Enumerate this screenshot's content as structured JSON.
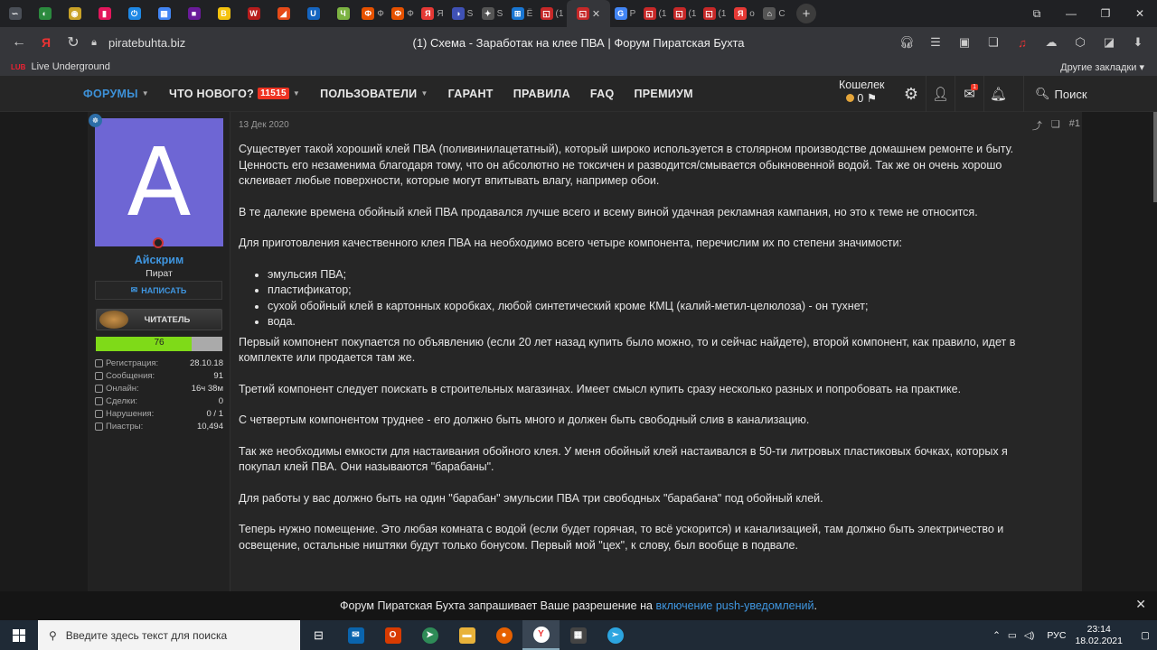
{
  "browser": {
    "tabs": [
      {
        "label": "",
        "color": "#4a4f57",
        "glyph": "∽"
      },
      {
        "label": "",
        "color": "#2b8a3e",
        "glyph": "◐"
      },
      {
        "label": "",
        "color": "#c9a227",
        "glyph": "◉"
      },
      {
        "label": "",
        "color": "#e3175c",
        "glyph": "▮"
      },
      {
        "label": "",
        "color": "#1e88e5",
        "glyph": "⏻"
      },
      {
        "label": "",
        "color": "#4285f4",
        "glyph": "▦"
      },
      {
        "label": "",
        "color": "#6a1b9a",
        "glyph": "■"
      },
      {
        "label": "",
        "color": "#f4c20d",
        "glyph": "B"
      },
      {
        "label": "",
        "color": "#b71c1c",
        "glyph": "W"
      },
      {
        "label": "",
        "color": "#e64a19",
        "glyph": "◢"
      },
      {
        "label": "",
        "color": "#1565c0",
        "glyph": "U"
      },
      {
        "label": "",
        "color": "#7cb342",
        "glyph": "Ч"
      },
      {
        "label": "Ф",
        "color": "#e65100",
        "glyph": "Ф"
      },
      {
        "label": "Ф",
        "color": "#e65100",
        "glyph": "Ф"
      },
      {
        "label": "Я",
        "color": "#e53935",
        "glyph": "Я"
      },
      {
        "label": "S",
        "color": "#3f51b5",
        "glyph": "◑"
      },
      {
        "label": "S",
        "color": "#555",
        "glyph": "✦"
      },
      {
        "label": "Ё",
        "color": "#1976d2",
        "glyph": "⊞"
      },
      {
        "label": "(1",
        "color": "#c62828",
        "glyph": "◱"
      },
      {
        "label": "",
        "color": "#c62828",
        "glyph": "◱",
        "active": true
      },
      {
        "label": "P",
        "color": "#4285f4",
        "glyph": "G"
      },
      {
        "label": "(1",
        "color": "#c62828",
        "glyph": "◱"
      },
      {
        "label": "(1",
        "color": "#c62828",
        "glyph": "◱"
      },
      {
        "label": "(1",
        "color": "#c62828",
        "glyph": "◱"
      },
      {
        "label": "о",
        "color": "#e53935",
        "glyph": "Я"
      },
      {
        "label": "C",
        "color": "#555",
        "glyph": "⌂"
      }
    ],
    "new_tab_label": "+",
    "address": "piratebuhta.biz",
    "page_title": "(1) Схема - Заработак на клее ПВА | Форум Пиратская Бухта",
    "bookmark_logo": "LUB",
    "bookmark_item": "Live Underground",
    "other_bookmarks": "Другие закладки"
  },
  "forum_nav": {
    "items": [
      {
        "label": "ФОРУМЫ",
        "active": true,
        "caret": true
      },
      {
        "label": "ЧТО НОВОГО?",
        "badge": "11515",
        "caret": true
      },
      {
        "label": "ПОЛЬЗОВАТЕЛИ",
        "caret": true
      },
      {
        "label": "ГАРАНТ"
      },
      {
        "label": "ПРАВИЛА"
      },
      {
        "label": "FAQ"
      },
      {
        "label": "ПРЕМИУМ"
      }
    ],
    "wallet_label": "Кошелек",
    "wallet_value": "0",
    "messages_badge": "1",
    "search_label": "Поиск"
  },
  "user": {
    "avatar_letter": "A",
    "avatar_color": "#6e66d4",
    "name": "Айскрим",
    "role": "Пират",
    "write_label": "НАПИСАТЬ",
    "rank_label": "ЧИТАТЕЛЬ",
    "progress_value": "76",
    "progress_fraction": 0.76,
    "stats": [
      {
        "label": "Регистрация:",
        "value": "28.10.18"
      },
      {
        "label": "Сообщения:",
        "value": "91"
      },
      {
        "label": "Онлайн:",
        "value": "16ч 38м"
      },
      {
        "label": "Сделки:",
        "value": "0"
      },
      {
        "label": "Нарушения:",
        "value": "0 / 1"
      },
      {
        "label": "Пиастры:",
        "value": "10,494"
      }
    ]
  },
  "post": {
    "date": "13 Дек 2020",
    "number": "#1",
    "p1": "Существует такой хороший клей ПВА (поливинилацетатный), который широко используется в столярном производстве домашнем ремонте и быту. Ценность его незаменима благодаря тому, что он абсолютно не токсичен и разводится/смывается обыкновенной водой. Так же он очень хорошо склеивает любые поверхности, которые могут впитывать влагу, например обои.",
    "p2": "В те далекие времена обойный клей ПВА продавался лучше всего и всему виной удачная рекламная кампания, но это к теме не относится.",
    "p3": "Для приготовления качественного клея ПВА на необходимо всего четыре компонента, перечислим их по степени значимости:",
    "list": [
      "эмульсия ПВА;",
      "пластификатор;",
      "сухой обойный клей в картонных коробках, любой синтетический кроме КМЦ (калий-метил-целюлоза) - он тухнет;",
      "вода."
    ],
    "p4": "Первый компонент покупается по объявлению (если 20 лет назад купить было можно, то и сейчас найдете), второй компонент, как правило, идет в комплекте или продается там же.",
    "p5": "Третий компонент следует поискать в строительных магазинах. Имеет смысл купить сразу несколько разных и попробовать на практике.",
    "p6": "С четвертым компонентом труднее - его должно быть много и должен быть свободный слив в канализацию.",
    "p7": "Так же необходимы емкости для настаивания обойного клея. У меня обойный клей настаивался в 50-ти литровых пластиковых бочках, которых я покупал клей ПВА. Они называются \"барабаны\".",
    "p8": "Для работы у вас должно быть на один \"барабан\" эмульсии ПВА три свободных \"барабана\" под обойный клей.",
    "p9": "Теперь нужно помещение. Это любая комната с водой (если будет горячая, то всё ускорится) и канализацией, там должно быть электричество и освещение, остальные ништяки будут только бонусом. Первый мой \"цех\", к слову, был вообще в подвале."
  },
  "push": {
    "text": "Форум Пиратская Бухта запрашивает Ваше разрешение на",
    "link": "включение push-уведомлений",
    "end": "."
  },
  "taskbar": {
    "search_placeholder": "Введите здесь текст для поиска",
    "lang": "РУС",
    "time": "23:14",
    "date": "18.02.2021"
  }
}
